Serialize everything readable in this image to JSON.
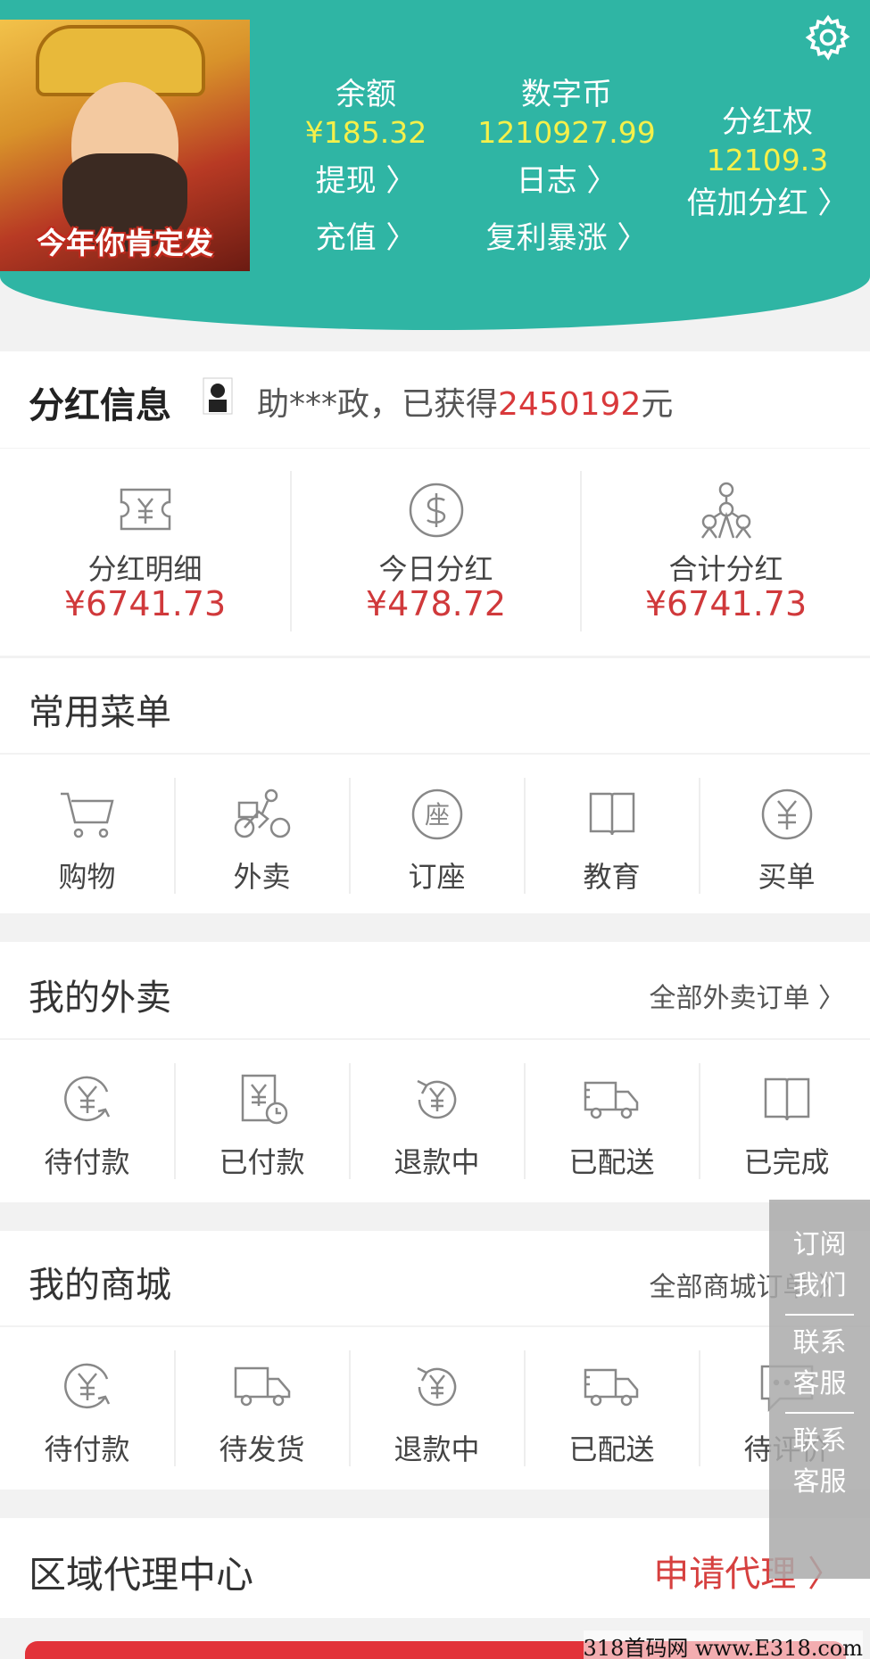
{
  "header": {
    "avatar_caption": "今年你肯定发",
    "balance": {
      "label": "余额",
      "value": "¥185.32",
      "action1": "提现 〉",
      "action2": "充值 〉"
    },
    "coin": {
      "label": "数字币",
      "value": "1210927.99",
      "action1": "日志 〉",
      "action2": "复利暴涨 〉"
    },
    "dividend_right": {
      "label": "分红权",
      "value": "12109.3",
      "action1": "倍加分红 〉"
    }
  },
  "dividend_info": {
    "title": "分红信息",
    "ticker_prefix": "助***政，已获得",
    "ticker_amount": "2450192",
    "ticker_suffix": "元",
    "stats": [
      {
        "label": "分红明细",
        "value": "¥6741.73",
        "icon": "yen-ticket-icon"
      },
      {
        "label": "今日分红",
        "value": "¥478.72",
        "icon": "dollar-circle-icon"
      },
      {
        "label": "合计分红",
        "value": "¥6741.73",
        "icon": "network-icon"
      }
    ]
  },
  "common_menu": {
    "title": "常用菜单",
    "items": [
      {
        "label": "购物",
        "icon": "cart-icon"
      },
      {
        "label": "外卖",
        "icon": "delivery-bike-icon"
      },
      {
        "label": "订座",
        "icon": "seat-icon"
      },
      {
        "label": "教育",
        "icon": "book-icon"
      },
      {
        "label": "买单",
        "icon": "yen-circle-icon"
      }
    ]
  },
  "takeout": {
    "title": "我的外卖",
    "more": "全部外卖订单 〉",
    "items": [
      {
        "label": "待付款",
        "icon": "yen-refresh-icon"
      },
      {
        "label": "已付款",
        "icon": "yen-clock-icon"
      },
      {
        "label": "退款中",
        "icon": "refund-icon"
      },
      {
        "label": "已配送",
        "icon": "truck-icon"
      },
      {
        "label": "已完成",
        "icon": "book-icon"
      }
    ]
  },
  "mall": {
    "title": "我的商城",
    "more": "全部商城订单 〉",
    "items": [
      {
        "label": "待付款",
        "icon": "yen-refresh-icon"
      },
      {
        "label": "待发货",
        "icon": "truck-icon"
      },
      {
        "label": "退款中",
        "icon": "refund-icon"
      },
      {
        "label": "已配送",
        "icon": "fast-truck-icon"
      },
      {
        "label": "待评价",
        "icon": "comment-icon"
      }
    ]
  },
  "region": {
    "title": "区域代理中心",
    "apply": "申请代理 〉"
  },
  "float_panel": {
    "subscribe_1": "订阅",
    "subscribe_2": "我们",
    "service_1": "联系",
    "service_2": "客服",
    "service_3": "联系",
    "service_4": "客服"
  },
  "watermark": "318首码网 www.E318.com",
  "colors": {
    "header": "#2fb5a4",
    "value_yellow": "#f5f04a",
    "accent_red": "#d0393b"
  }
}
